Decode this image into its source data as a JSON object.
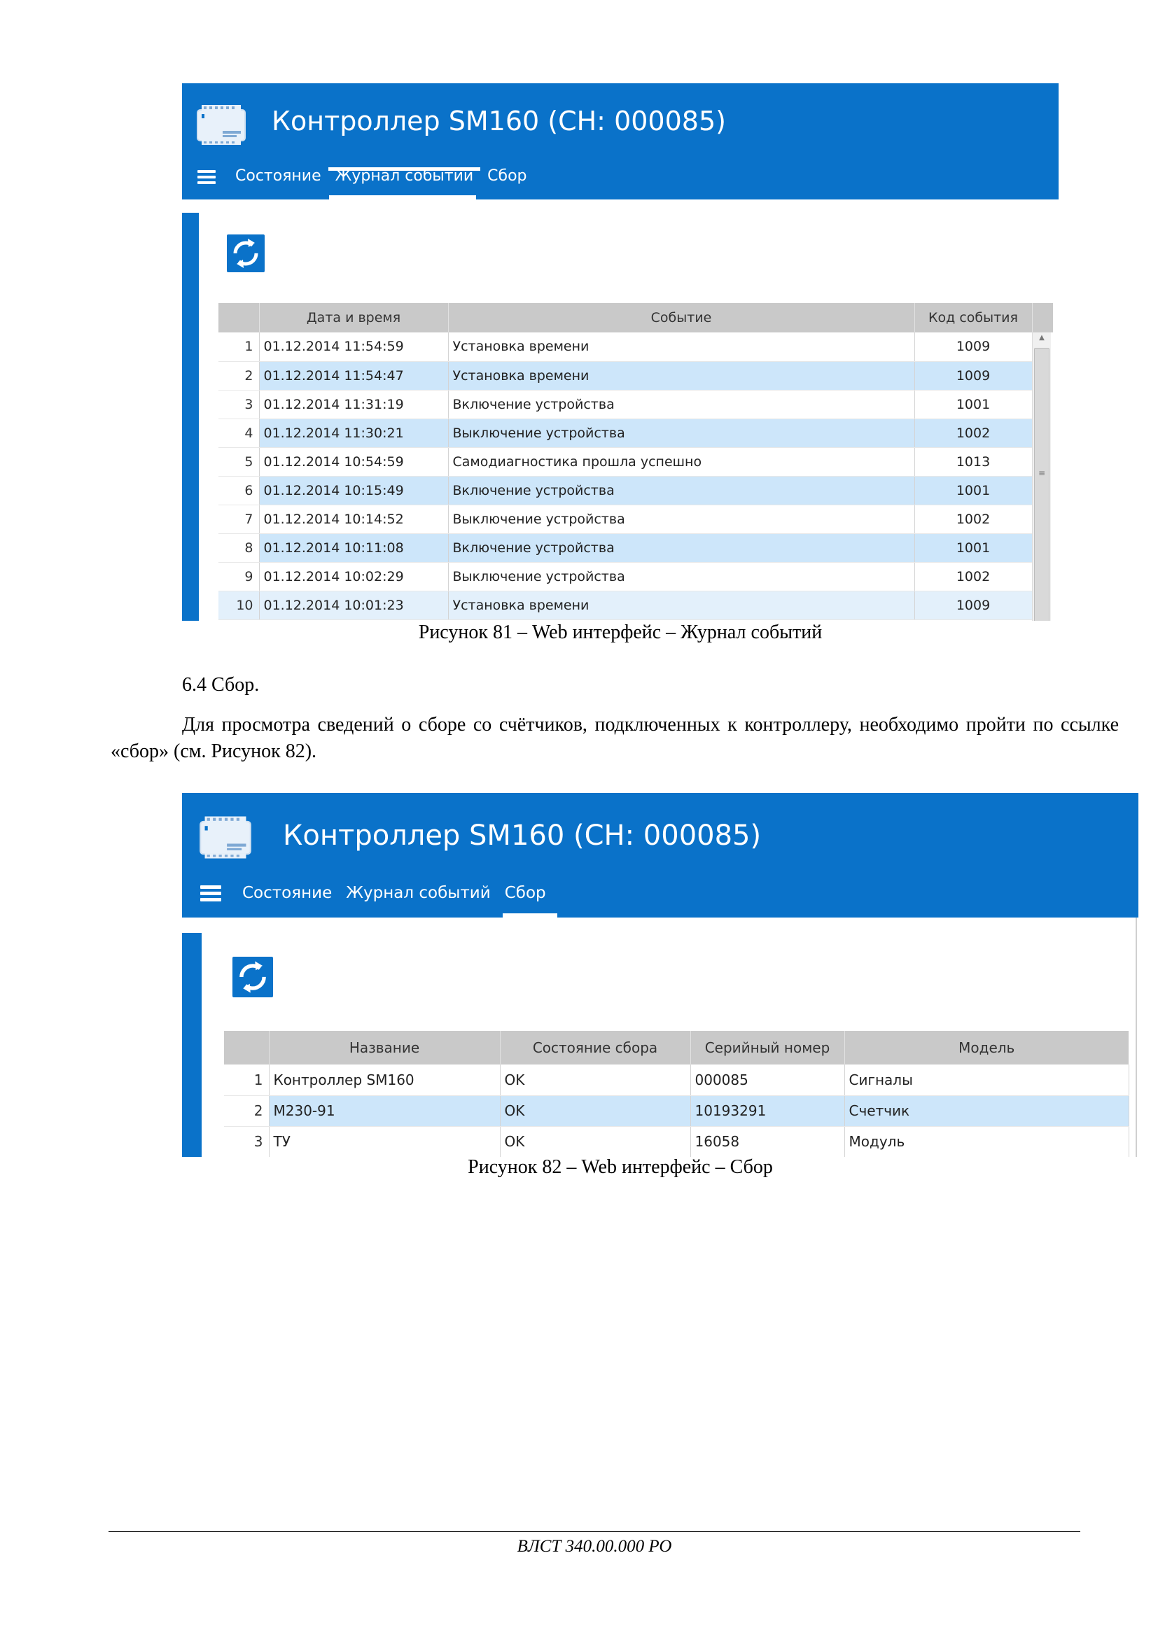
{
  "figure81": {
    "app_title": "Контроллер SM160 (СН: 000085)",
    "nav": [
      "Состояние",
      "Журнал событий",
      "Сбор"
    ],
    "active_tab": 1,
    "columns": [
      "Дата и время",
      "Событие",
      "Код события"
    ],
    "rows": [
      {
        "n": "1",
        "dt": "01.12.2014 11:54:59",
        "event": "Установка времени",
        "code": "1009"
      },
      {
        "n": "2",
        "dt": "01.12.2014 11:54:47",
        "event": "Установка времени",
        "code": "1009"
      },
      {
        "n": "3",
        "dt": "01.12.2014 11:31:19",
        "event": "Включение устройства",
        "code": "1001"
      },
      {
        "n": "4",
        "dt": "01.12.2014 11:30:21",
        "event": "Выключение устройства",
        "code": "1002"
      },
      {
        "n": "5",
        "dt": "01.12.2014 10:54:59",
        "event": "Самодиагностика прошла успешно",
        "code": "1013"
      },
      {
        "n": "6",
        "dt": "01.12.2014 10:15:49",
        "event": "Включение устройства",
        "code": "1001"
      },
      {
        "n": "7",
        "dt": "01.12.2014 10:14:52",
        "event": "Выключение устройства",
        "code": "1002"
      },
      {
        "n": "8",
        "dt": "01.12.2014 10:11:08",
        "event": "Включение устройства",
        "code": "1001"
      },
      {
        "n": "9",
        "dt": "01.12.2014 10:02:29",
        "event": "Выключение устройства",
        "code": "1002"
      },
      {
        "n": "10",
        "dt": "01.12.2014 10:01:23",
        "event": "Установка времени",
        "code": "1009"
      }
    ],
    "caption": "Рисунок 81 – Web интерфейс – Журнал событий"
  },
  "section_heading": "6.4 Сбор.",
  "paragraph": "Для просмотра сведений о сборе со счётчиков, подключенных к контроллеру, необходимо пройти по ссылке «сбор» (см. Рисунок 82).",
  "figure82": {
    "app_title": "Контроллер SM160 (СН: 000085)",
    "nav": [
      "Состояние",
      "Журнал событий",
      "Сбор"
    ],
    "active_tab": 2,
    "columns": [
      "Название",
      "Состояние сбора",
      "Серийный номер",
      "Модель"
    ],
    "rows": [
      {
        "n": "1",
        "name": "Контроллер SM160",
        "state": "OK",
        "serial": "000085",
        "model": "Сигналы"
      },
      {
        "n": "2",
        "name": "M230-91",
        "state": "OK",
        "serial": "10193291",
        "model": "Счетчик"
      },
      {
        "n": "3",
        "name": "ТУ",
        "state": "OK",
        "serial": "16058",
        "model": "Модуль"
      }
    ],
    "caption": "Рисунок 82 – Web интерфейс – Сбор"
  },
  "footer": "ВЛСТ 340.00.000 РО",
  "colors": {
    "brand_blue": "#0a72c9",
    "row_alt": "#cde6fa",
    "header_gray": "#c9c9c9"
  },
  "icons": [
    "controller-device-icon",
    "hamburger-menu-icon",
    "refresh-icon"
  ]
}
